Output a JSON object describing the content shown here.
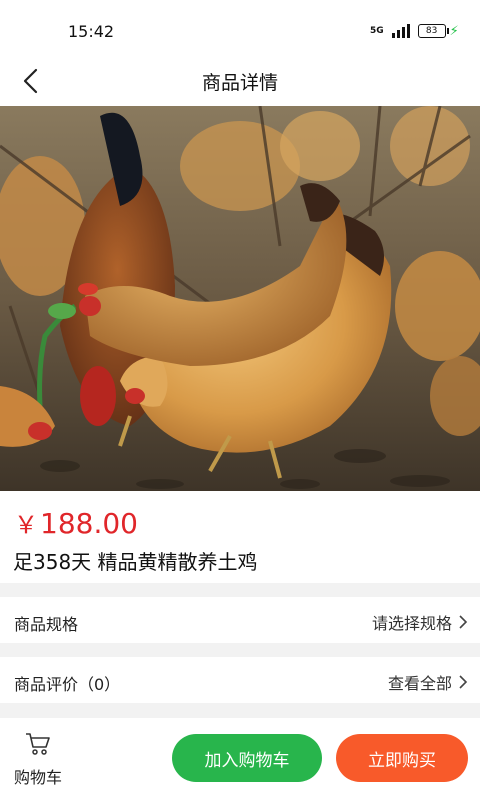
{
  "status_bar": {
    "time": "15:42",
    "network": "5G",
    "battery": "83"
  },
  "header": {
    "title": "商品详情"
  },
  "product": {
    "currency": "￥",
    "price": "188.00",
    "title": "足358天 精品黄精散养土鸡"
  },
  "spec_row": {
    "label": "商品规格",
    "value": "请选择规格"
  },
  "review_row": {
    "label": "商品评价（0）",
    "value": "查看全部"
  },
  "bottom_bar": {
    "cart_label": "购物车",
    "add_to_cart": "加入购物车",
    "buy_now": "立即购买"
  },
  "colors": {
    "price": "#e0262a",
    "add_to_cart": "#28b54c",
    "buy_now": "#f85a2a"
  },
  "icons": [
    "back-arrow-icon",
    "chevron-right-icon",
    "shopping-cart-icon",
    "signal-icon",
    "battery-icon"
  ]
}
